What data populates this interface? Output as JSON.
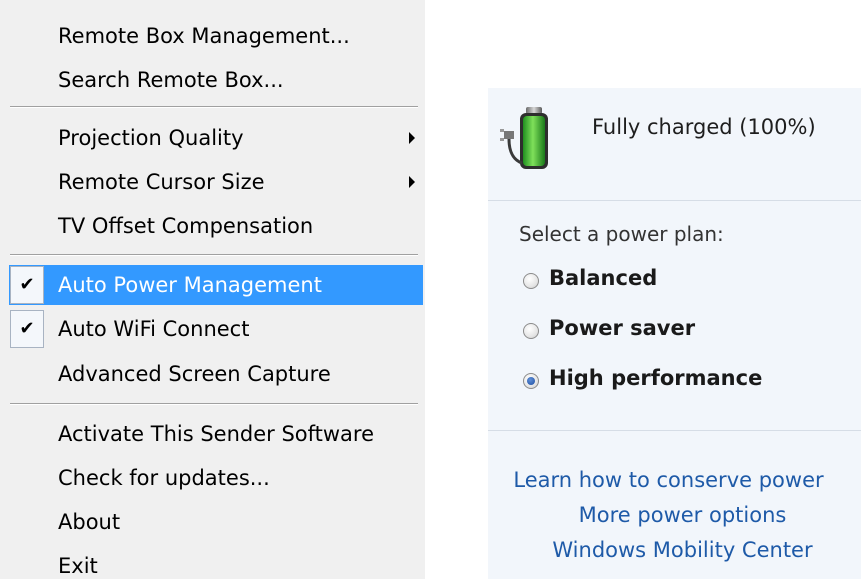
{
  "context_menu": {
    "items": [
      {
        "label": "Remote Box Management...",
        "submenu": false,
        "checked": false
      },
      {
        "label": "Search Remote Box...",
        "submenu": false,
        "checked": false
      },
      {
        "label": "Projection Quality",
        "submenu": true,
        "checked": false
      },
      {
        "label": "Remote Cursor Size",
        "submenu": true,
        "checked": false
      },
      {
        "label": "TV Offset Compensation",
        "submenu": false,
        "checked": false
      },
      {
        "label": "Auto Power Management",
        "submenu": false,
        "checked": true,
        "highlighted": true
      },
      {
        "label": "Auto WiFi Connect",
        "submenu": false,
        "checked": true
      },
      {
        "label": "Advanced Screen Capture",
        "submenu": false,
        "checked": false
      },
      {
        "label": "Activate This Sender Software",
        "submenu": false,
        "checked": false
      },
      {
        "label": "Check for updates...",
        "submenu": false,
        "checked": false
      },
      {
        "label": "About",
        "submenu": false,
        "checked": false
      },
      {
        "label": "Exit",
        "submenu": false,
        "checked": false
      }
    ],
    "check_glyph": "✔",
    "highlight_color": "#3399ff"
  },
  "power_flyout": {
    "battery_icon": "battery-full-plugged-icon",
    "status": "Fully charged (100%)",
    "plan_header": "Select a power plan:",
    "plans": [
      {
        "label": "Balanced",
        "selected": false
      },
      {
        "label": "Power saver",
        "selected": false
      },
      {
        "label": "High performance",
        "selected": true
      }
    ],
    "links": [
      "Learn how to conserve power",
      "More power options",
      "Windows Mobility Center"
    ],
    "link_color": "#1e5aa8"
  }
}
